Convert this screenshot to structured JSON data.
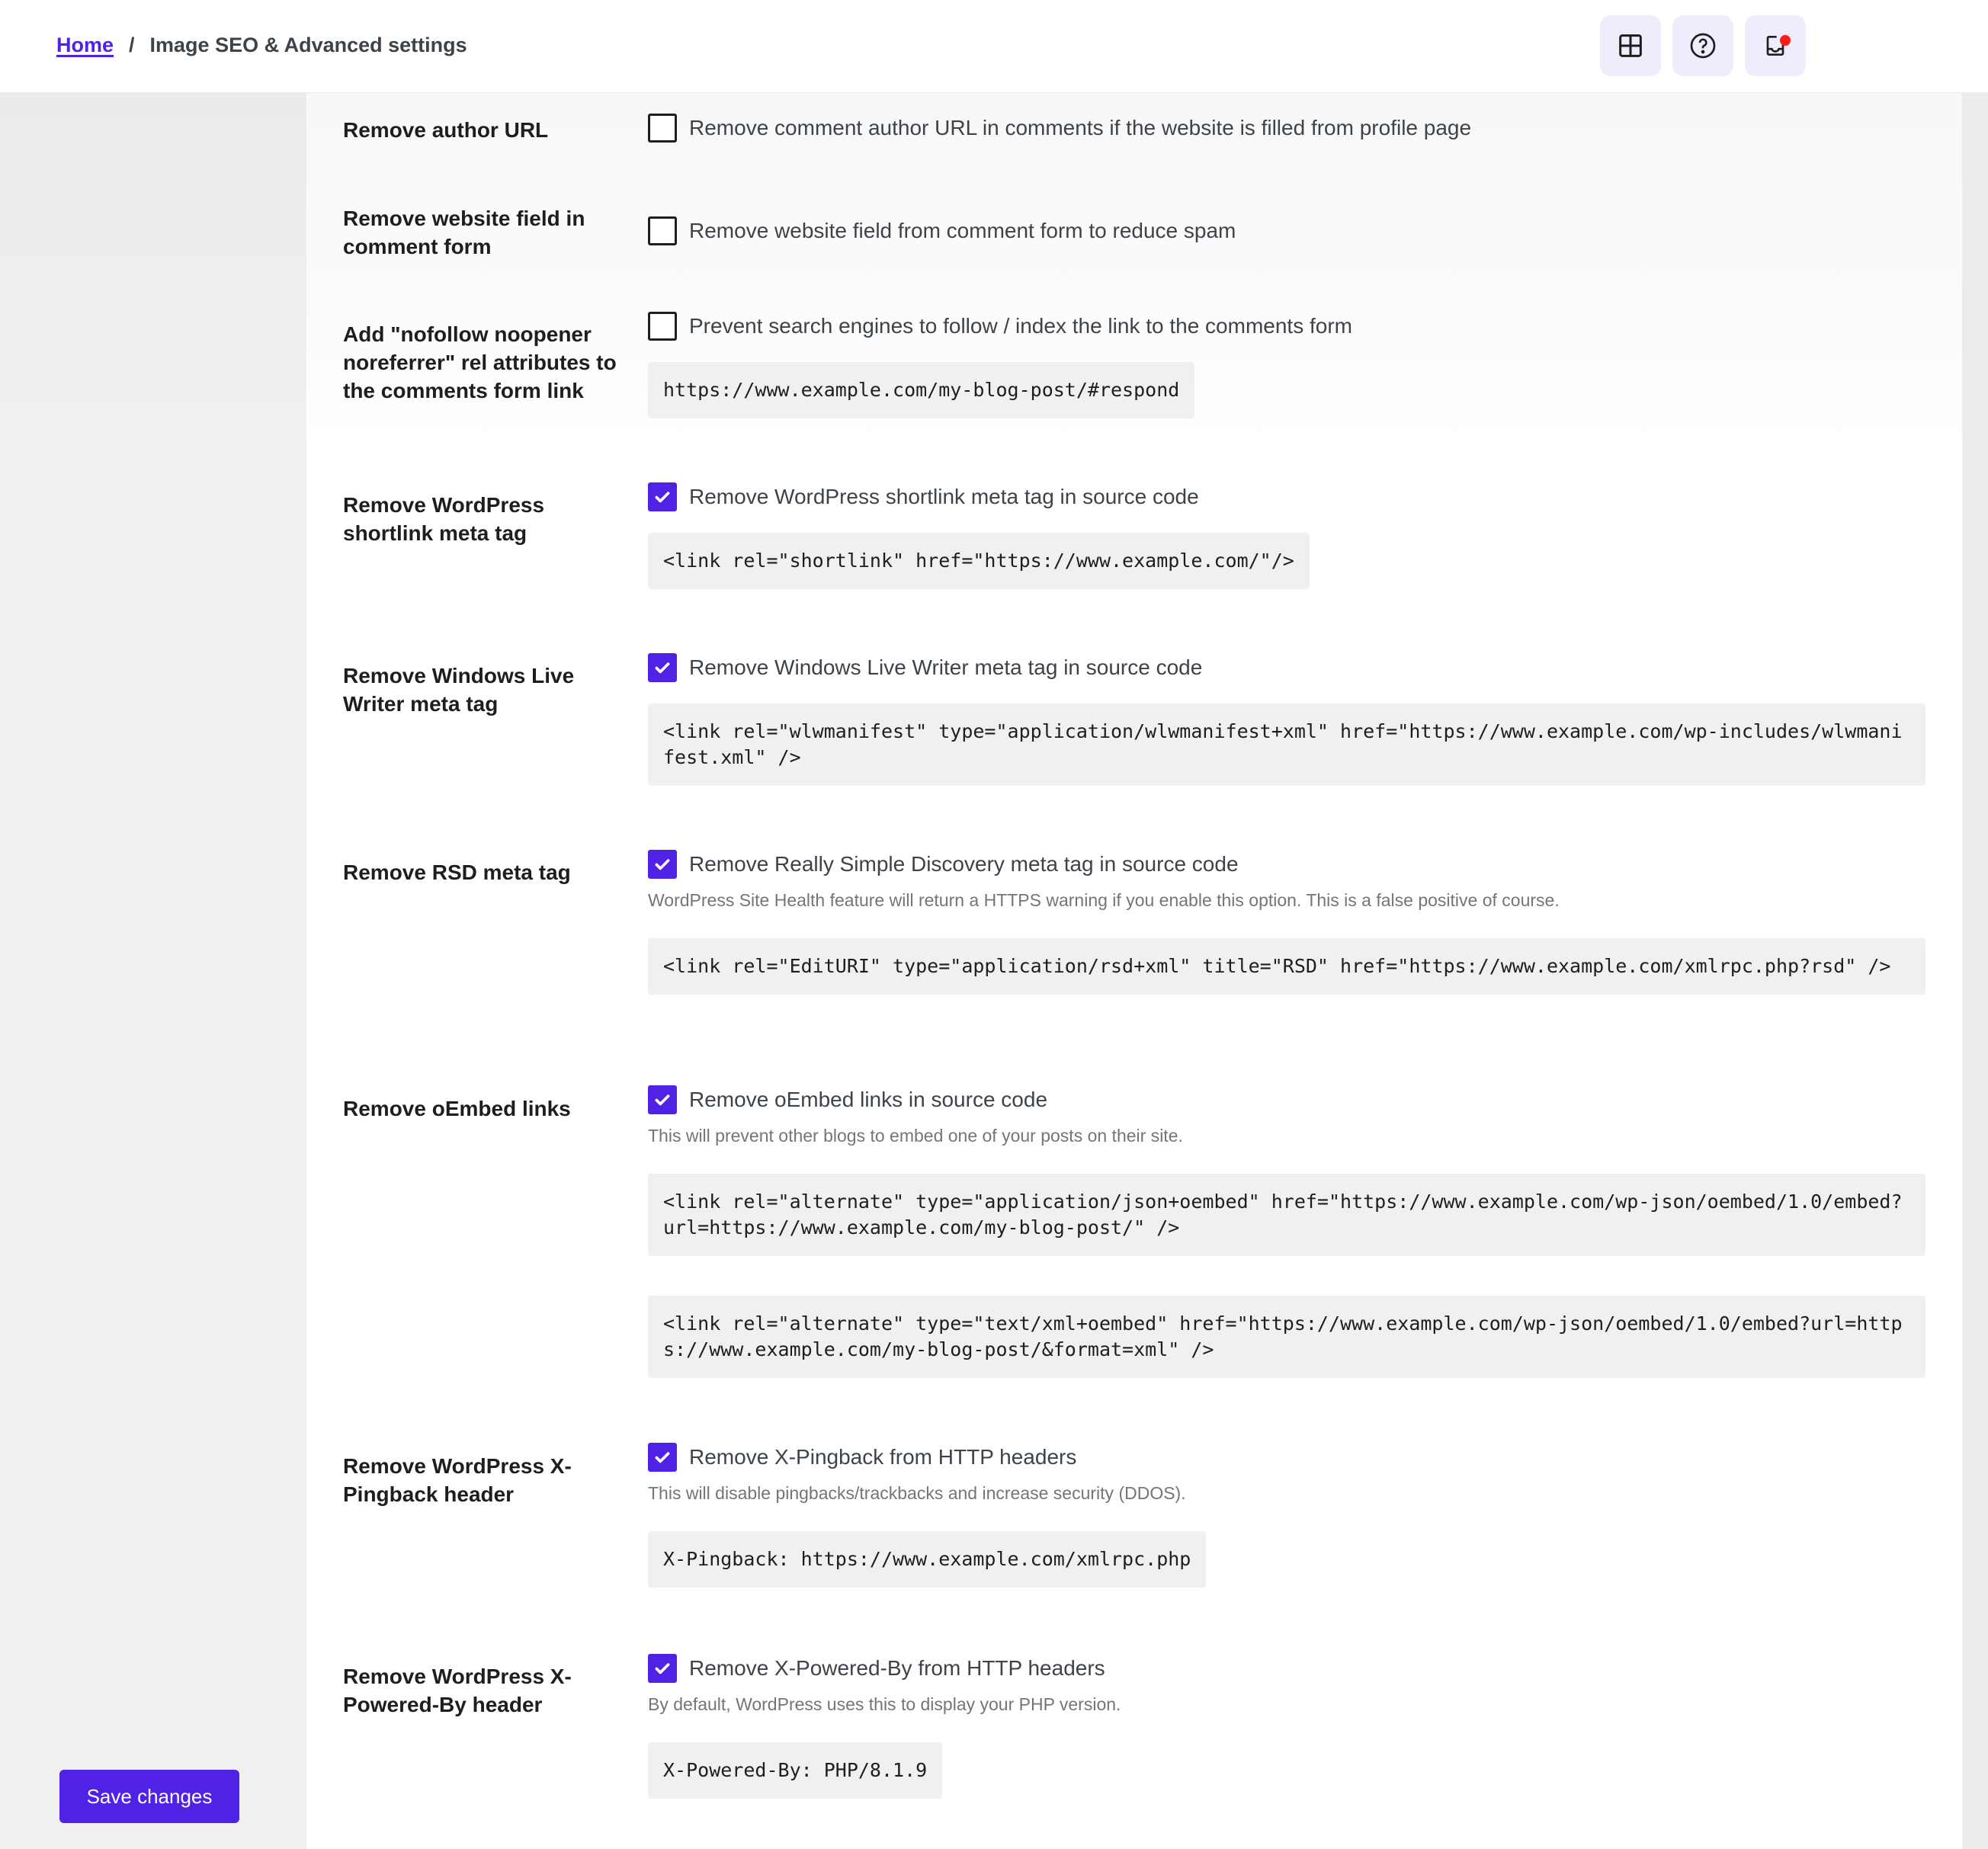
{
  "header": {
    "breadcrumb": {
      "home": "Home",
      "separator": "/",
      "current": "Image SEO & Advanced settings"
    },
    "actions": [
      {
        "icon": "grid-icon"
      },
      {
        "icon": "help-circle-icon"
      },
      {
        "icon": "inbox-icon",
        "notification": true
      }
    ]
  },
  "accent_color": "#4f22e5",
  "footer": {
    "save_label": "Save changes"
  },
  "settings": [
    {
      "label": "Remove author URL",
      "checked": false,
      "option": "Remove comment author URL in comments if the website is filled from profile page"
    },
    {
      "label": "Remove website field in comment form",
      "checked": false,
      "option": "Remove website field from comment form to reduce spam"
    },
    {
      "label": "Add \"nofollow noopener noreferrer\" rel attributes to the comments form link",
      "checked": false,
      "option": "Prevent search engines to follow / index the link to the comments form",
      "code": [
        "https://www.example.com/my-blog-post/#respond"
      ]
    },
    {
      "label": "Remove WordPress shortlink meta tag",
      "checked": true,
      "option": "Remove WordPress shortlink meta tag in source code",
      "code": [
        "<link rel=\"shortlink\" href=\"https://www.example.com/\"/>"
      ]
    },
    {
      "label": "Remove Windows Live Writer meta tag",
      "checked": true,
      "option": "Remove Windows Live Writer meta tag in source code",
      "code": [
        "<link rel=\"wlwmanifest\" type=\"application/wlwmanifest+xml\" href=\"https://www.example.com/wp-includes/wlwmanifest.xml\" />"
      ]
    },
    {
      "label": "Remove RSD meta tag",
      "checked": true,
      "option": "Remove Really Simple Discovery meta tag in source code",
      "description": "WordPress Site Health feature will return a HTTPS warning if you enable this option. This is a false positive of course.",
      "code": [
        "<link rel=\"EditURI\" type=\"application/rsd+xml\" title=\"RSD\" href=\"https://www.example.com/xmlrpc.php?rsd\" />"
      ]
    },
    {
      "label": "Remove oEmbed links",
      "checked": true,
      "option": "Remove oEmbed links in source code",
      "description": "This will prevent other blogs to embed one of your posts on their site.",
      "code": [
        "<link rel=\"alternate\" type=\"application/json+oembed\" href=\"https://www.example.com/wp-json/oembed/1.0/embed?url=https://www.example.com/my-blog-post/\" />",
        "<link rel=\"alternate\" type=\"text/xml+oembed\" href=\"https://www.example.com/wp-json/oembed/1.0/embed?url=https://www.example.com/my-blog-post/&format=xml\" />"
      ]
    },
    {
      "label": "Remove WordPress X-Pingback header",
      "checked": true,
      "option": "Remove X-Pingback from HTTP headers",
      "description": "This will disable pingbacks/trackbacks and increase security (DDOS).",
      "code": [
        "X-Pingback: https://www.example.com/xmlrpc.php"
      ]
    },
    {
      "label": "Remove WordPress X-Powered-By header",
      "checked": true,
      "option": "Remove X-Powered-By from HTTP headers",
      "description": "By default, WordPress uses this to display your PHP version.",
      "code": [
        "X-Powered-By: PHP/8.1.9"
      ]
    }
  ]
}
